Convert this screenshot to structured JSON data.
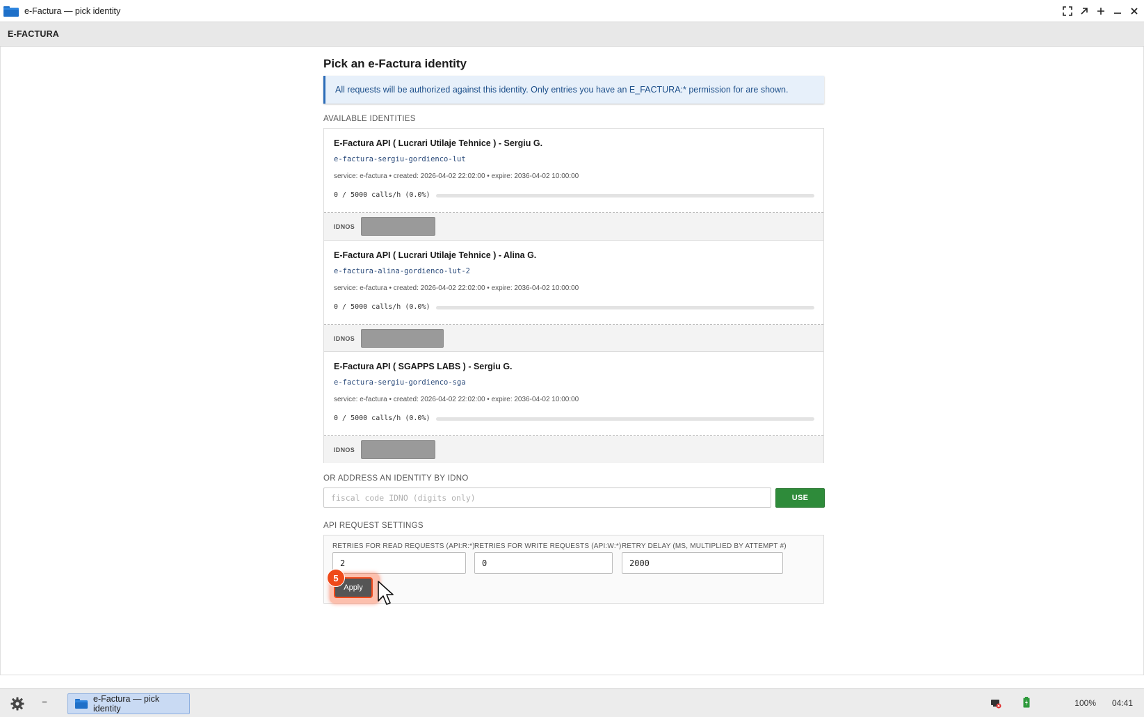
{
  "window": {
    "title": "e-Factura — pick identity",
    "controls": [
      "fullscreen-icon",
      "restore-icon",
      "plus-icon",
      "minimize-icon",
      "close-icon"
    ]
  },
  "app": {
    "brand": "E-FACTURA"
  },
  "page": {
    "title": "Pick an e-Factura identity",
    "info": "All requests will be authorized against this identity. Only entries you have an E_FACTURA:* permission for are shown.",
    "available_label": "AVAILABLE IDENTITIES"
  },
  "identities": [
    {
      "name": "E-Factura API ( Lucrari Utilaje Tehnice ) - Sergiu G.",
      "slug": "e-factura-sergiu-gordienco-lut",
      "meta": "service: e-factura • created: 2026-04-02 22:02:00 • expire: 2036-04-02 10:00:00",
      "usage": "0 / 5000 calls/h (0.0%)",
      "usage_fraction": 0.0,
      "idnos_label": "IDNOS"
    },
    {
      "name": "E-Factura API ( Lucrari Utilaje Tehnice ) - Alina G.",
      "slug": "e-factura-alina-gordienco-lut-2",
      "meta": "service: e-factura • created: 2026-04-02 22:02:00 • expire: 2036-04-02 10:00:00",
      "usage": "0 / 5000 calls/h (0.0%)",
      "usage_fraction": 0.0,
      "idnos_label": "IDNOS"
    },
    {
      "name": "E-Factura API ( SGAPPS LABS ) - Sergiu G.",
      "slug": "e-factura-sergiu-gordienco-sga",
      "meta": "service: e-factura • created: 2026-04-02 22:02:00 • expire: 2036-04-02 10:00:00",
      "usage": "0 / 5000 calls/h (0.0%)",
      "usage_fraction": 0.0,
      "idnos_label": "IDNOS"
    }
  ],
  "idno_address": {
    "label": "OR ADDRESS AN IDENTITY BY IDNO",
    "placeholder": "fiscal code IDNO (digits only)",
    "value": "",
    "button": "USE"
  },
  "api_settings": {
    "label": "API REQUEST SETTINGS",
    "read_retries_label": "RETRIES FOR READ REQUESTS (API:R:*)",
    "read_retries_value": "2",
    "write_retries_label": "RETRIES FOR WRITE REQUESTS (API:W:*)",
    "write_retries_value": "0",
    "retry_delay_label": "RETRY DELAY (MS, MULTIPLIED BY ATTEMPT #)",
    "retry_delay_value": "2000",
    "apply_button": "Apply",
    "step_badge": "5"
  },
  "taskbar": {
    "task_label": "e-Factura — pick identity",
    "battery": "100%",
    "clock": "04:41"
  },
  "colors": {
    "accent_blue": "#2b6cb8",
    "info_bg": "#e7f0fa",
    "use_green": "#2e8b3a",
    "highlight_orange": "#ef4a1a"
  }
}
